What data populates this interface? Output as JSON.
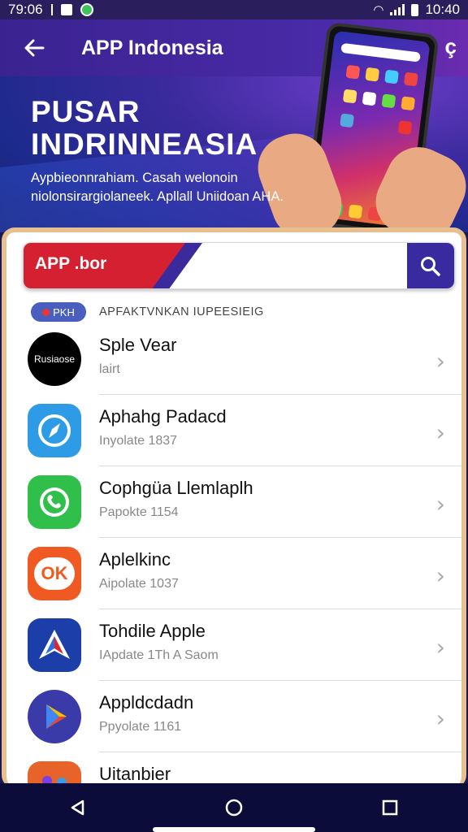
{
  "status_bar": {
    "time_left": "79:06",
    "time_right": "10:40"
  },
  "app_bar": {
    "title": "APP Indonesia",
    "settings_glyph": "ç"
  },
  "hero": {
    "title_line1": "PUSAR",
    "title_line2": "INDRINNEASIA",
    "subtitle_line1": "Aypbieonnrahiam. Casah welonoin",
    "subtitle_line2": "niolonsirargiolaneek. Apllall Uniidoan AHA."
  },
  "search": {
    "label": "APP .bor",
    "placeholder": ""
  },
  "section": {
    "pill": "PKH",
    "title": "APFAKTVNKAN IUPEESIEIG"
  },
  "apps": [
    {
      "name": "Sple Vear",
      "sub": "lairt",
      "icon": "rusiao-logo-icon",
      "icon_text": "Rusiaose",
      "bg": "#000000"
    },
    {
      "name": "Aphahg Padacd",
      "sub": "Inyolate 1837",
      "icon": "compass-icon",
      "bg": "#2e9be6"
    },
    {
      "name": "Cophgüa Llemlaplh",
      "sub": "Papokte 1154",
      "icon": "phone-chat-icon",
      "bg": "#2fbf4a"
    },
    {
      "name": "Aplelkinc",
      "sub": "Aipolate 1037",
      "icon": "ok-icon",
      "icon_text": "OK",
      "bg": "#f05a22"
    },
    {
      "name": "Tohdile Apple",
      "sub": "IApdate 1Th A Saom",
      "icon": "arrow-a-icon",
      "bg": "#1b3ea8"
    },
    {
      "name": "Appldcdadn",
      "sub": "Ppyolate 1161",
      "icon": "play-icon",
      "bg": "#3a3aa8"
    },
    {
      "name": "Uitanbier",
      "sub": "",
      "icon": "colorful-shapes-icon",
      "bg": "#e8632a"
    }
  ]
}
